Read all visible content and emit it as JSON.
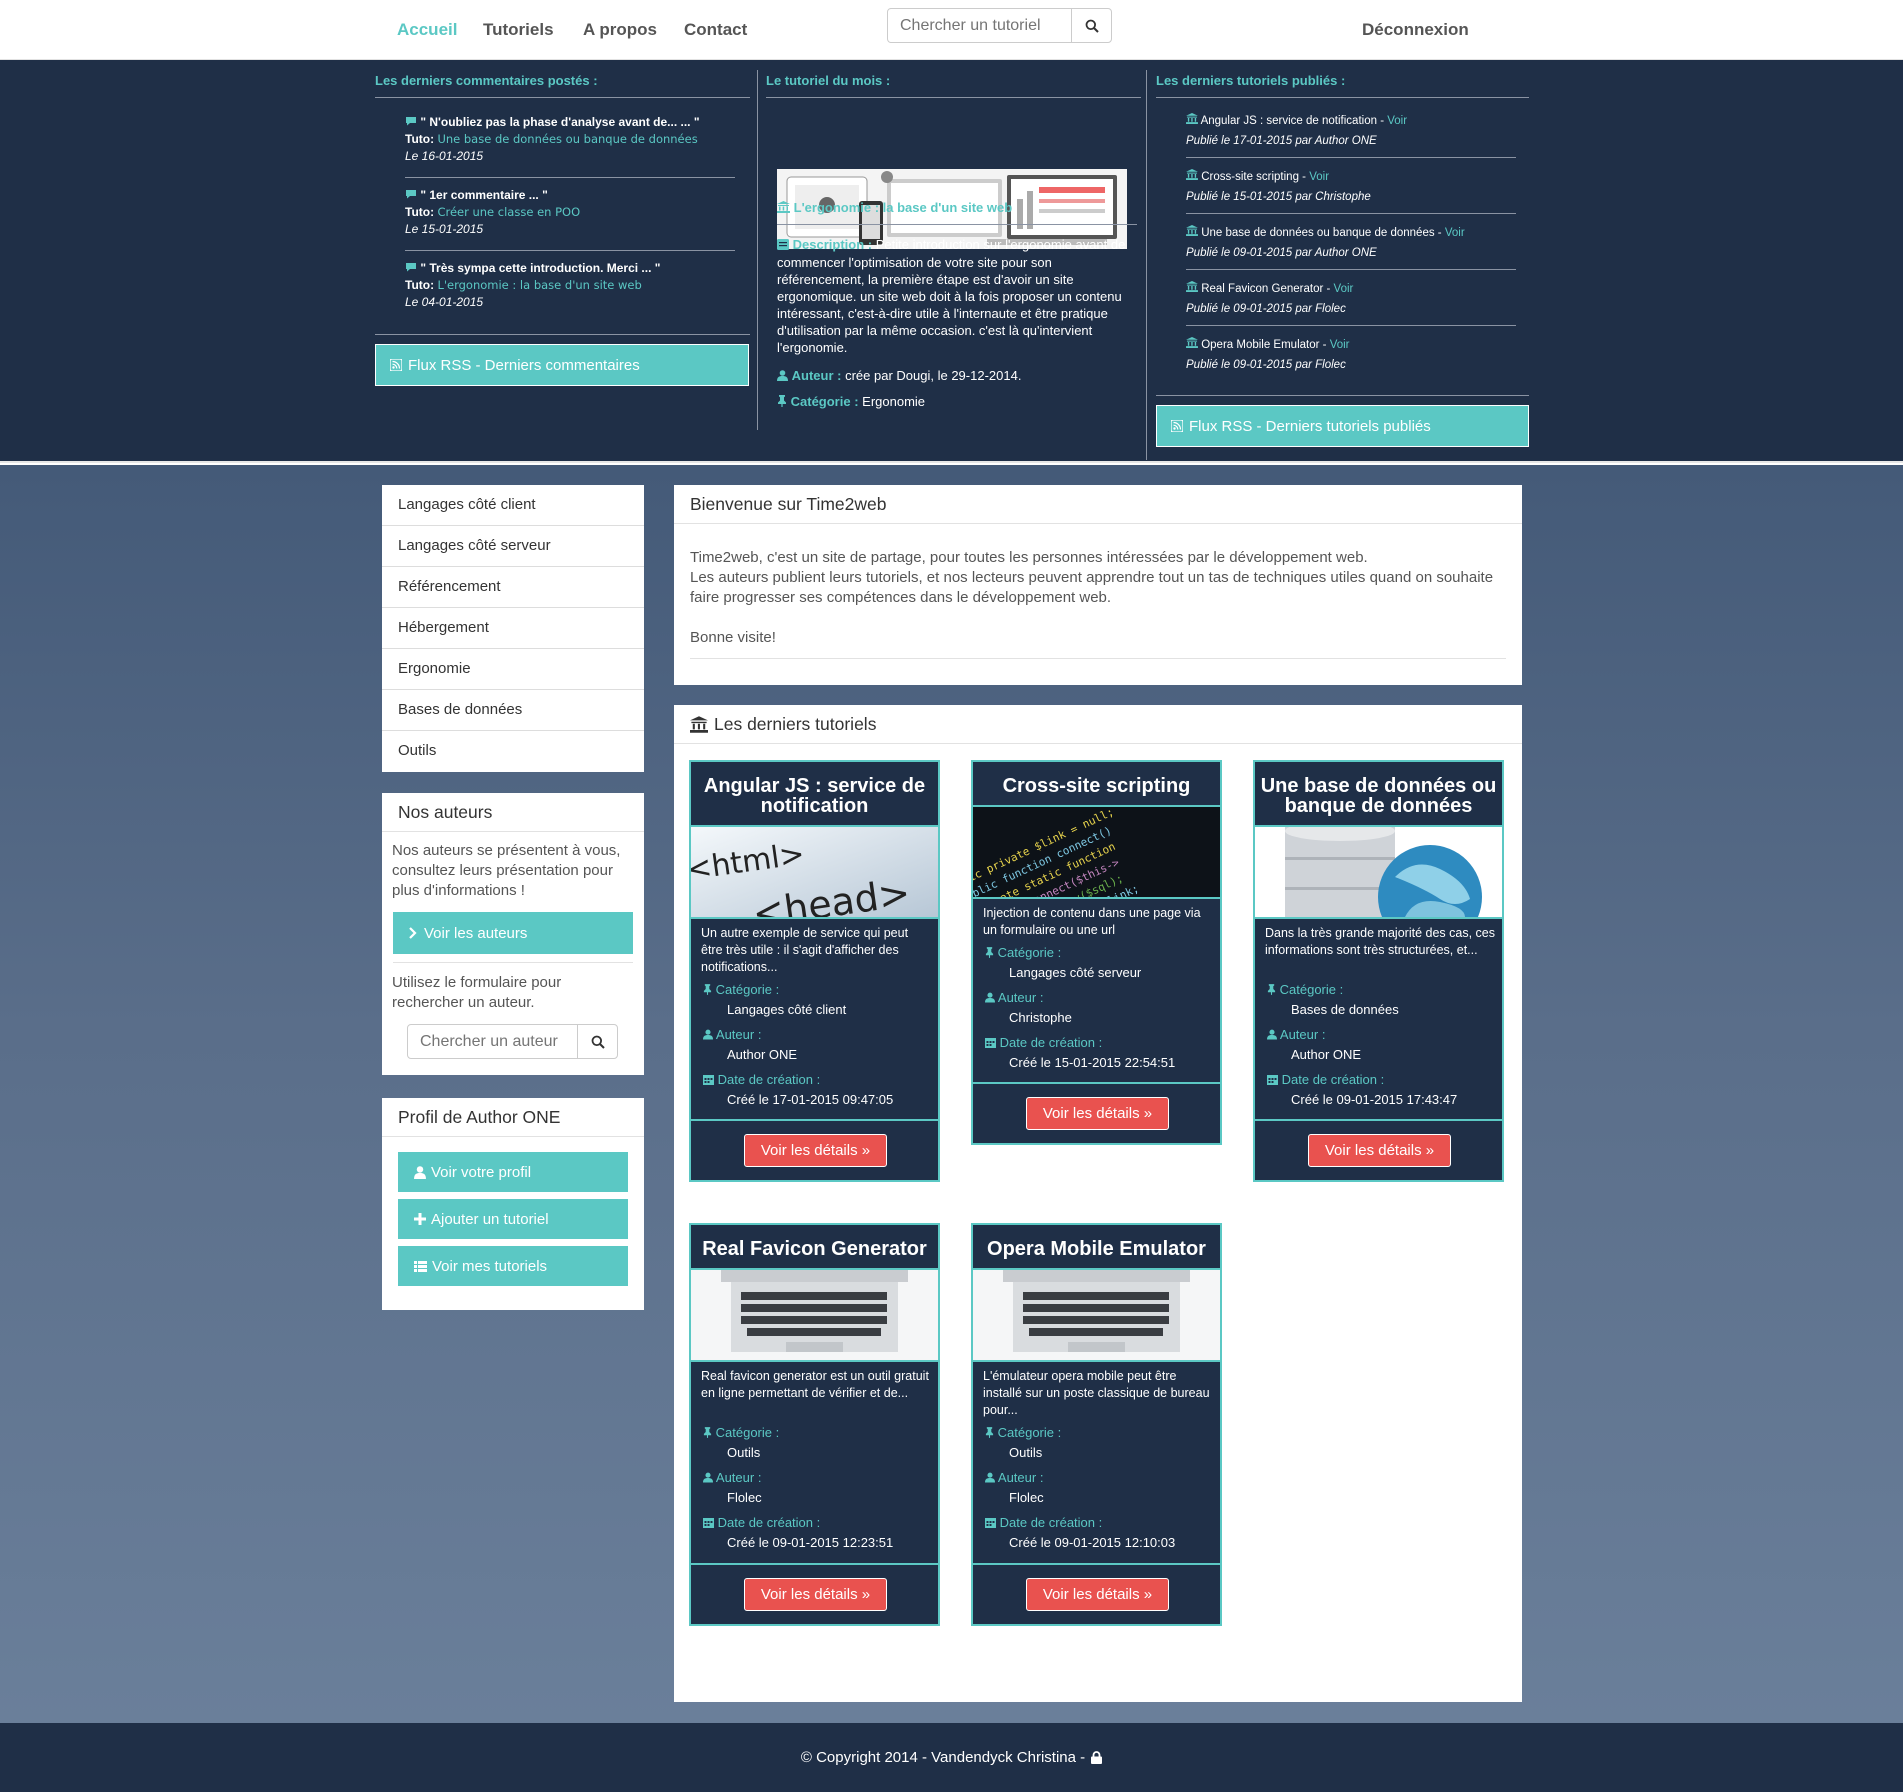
{
  "nav": {
    "items": [
      "Accueil",
      "Tutoriels",
      "A propos",
      "Contact"
    ],
    "search_placeholder": "Chercher un tutoriel",
    "logout": "Déconnexion"
  },
  "band": {
    "comments": {
      "title": "Les derniers commentaires postés :",
      "items": [
        {
          "quote": "\" N'oubliez pas la phase d'analyse avant de... ... \"",
          "tuto_label": "Tuto:",
          "tuto": "Une base de données ou banque de données",
          "date": "Le 16-01-2015"
        },
        {
          "quote": "\" 1er commentaire ... \"",
          "tuto_label": "Tuto:",
          "tuto": "Créer une classe en POO",
          "date": "Le 15-01-2015"
        },
        {
          "quote": "\" Très sympa cette introduction. Merci ... \"",
          "tuto_label": "Tuto:",
          "tuto": "L'ergonomie : la base d'un site web",
          "date": "Le 04-01-2015"
        }
      ],
      "rss": "Flux RSS - Derniers commentaires"
    },
    "month": {
      "title": "Le tutoriel du mois :",
      "name": "L'ergonomie : la base d'un site web",
      "desc_label": "Description :",
      "desc": "Petite introduction sur l'ergonomie avant de commencer l'optimisation de votre site pour son référencement, la première étape est d'avoir un site ergonomique. un site web doit à la fois proposer un contenu intéressant, c'est-à-dire utile à l'internaute et être pratique d'utilisation par la même occasion. c'est là qu'intervient l'ergonomie.",
      "author_label": "Auteur :",
      "author": "crée par Dougi, le 29-12-2014.",
      "cat_label": "Catégorie :",
      "cat": "Ergonomie"
    },
    "published": {
      "title": "Les derniers tutoriels publiés :",
      "voir": "Voir",
      "items": [
        {
          "name": "Angular JS : service de notification",
          "by": "Publié le 17-01-2015 par Author ONE"
        },
        {
          "name": "Cross-site scripting",
          "by": "Publié le 15-01-2015 par Christophe"
        },
        {
          "name": "Une base de données ou banque de données",
          "by": "Publié le 09-01-2015 par Author ONE"
        },
        {
          "name": "Real Favicon Generator",
          "by": "Publié le 09-01-2015 par Flolec"
        },
        {
          "name": "Opera Mobile Emulator",
          "by": "Publié le 09-01-2015 par Flolec"
        }
      ],
      "rss": "Flux RSS - Derniers tutoriels publiés"
    }
  },
  "sidebar": {
    "categories": [
      "Langages côté client",
      "Langages côté serveur",
      "Référencement",
      "Hébergement",
      "Ergonomie",
      "Bases de données",
      "Outils"
    ],
    "authors": {
      "title": "Nos auteurs",
      "text": "Nos auteurs se présentent à vous, consultez leurs présentation pour plus d'informations !",
      "button": "Voir les auteurs",
      "text2": "Utilisez le formulaire pour rechercher un auteur.",
      "search_placeholder": "Chercher un auteur"
    },
    "profile": {
      "title": "Profil de Author ONE",
      "buttons": [
        "Voir votre profil",
        "Ajouter un tutoriel",
        "Voir mes tutoriels"
      ]
    }
  },
  "welcome": {
    "title": "Bienvenue sur Time2web",
    "line1": "Time2web, c'est un site de partage, pour toutes les personnes intéressées par le développement web.",
    "line2": "Les auteurs publient leurs tutoriels, et nos lecteurs peuvent apprendre tout un tas de techniques utiles quand on souhaite faire progresser ses compétences dans le développement web.",
    "line3": "Bonne visite!"
  },
  "latest": {
    "title": "Les derniers tutoriels",
    "cat_label": "Catégorie :",
    "author_label": "Auteur :",
    "date_label": "Date de création :",
    "details": "Voir les détails »",
    "cards": [
      {
        "title": "Angular JS : service de notification",
        "desc": "Un autre exemple de service qui peut être très utile : il s'agit d'afficher des notifications...",
        "cat": "Langages côté client",
        "author": "Author ONE",
        "date": "Créé le 17-01-2015 09:47:05"
      },
      {
        "title": "Cross-site scripting",
        "desc": "Injection de contenu dans une page via un formulaire ou une url",
        "cat": "Langages côté serveur",
        "author": "Christophe",
        "date": "Créé le 15-01-2015 22:54:51"
      },
      {
        "title": "Une base de données ou banque de données",
        "desc": "Dans la très grande majorité des cas, ces informations sont très structurées, et...",
        "cat": "Bases de données",
        "author": "Author ONE",
        "date": "Créé le 09-01-2015 17:43:47"
      },
      {
        "title": "Real Favicon Generator",
        "desc": "Real favicon generator est un outil gratuit en ligne permettant de vérifier et de...",
        "cat": "Outils",
        "author": "Flolec",
        "date": "Créé le 09-01-2015 12:23:51"
      },
      {
        "title": "Opera Mobile Emulator",
        "desc": "L'émulateur opera mobile peut être installé sur un poste classique de bureau pour...",
        "cat": "Outils",
        "author": "Flolec",
        "date": "Créé le 09-01-2015 12:10:03"
      }
    ],
    "image_texts": {
      "html": "<html>",
      "head": "<head>"
    }
  },
  "footer": {
    "text": "© Copyright 2014 - Vandendyck Christina -"
  },
  "colors": {
    "teal": "#5bc8c4",
    "navy": "#1f2f47",
    "red": "#e9524f"
  }
}
